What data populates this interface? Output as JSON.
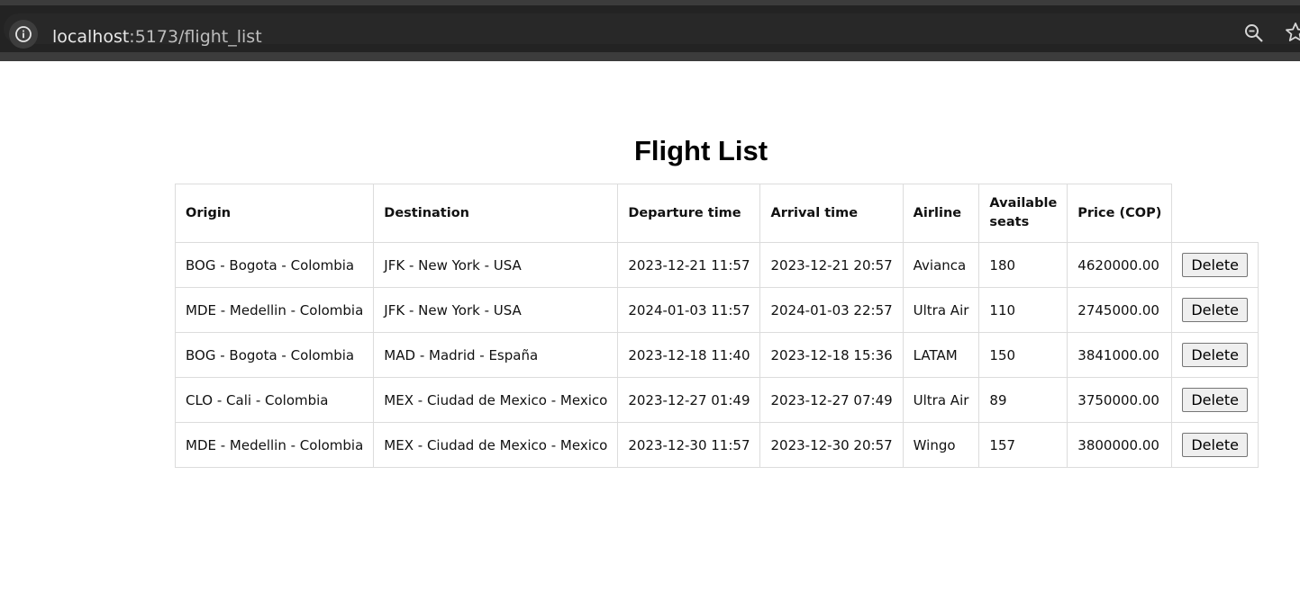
{
  "browser": {
    "url_host": "localhost",
    "url_path": ":5173/flight_list"
  },
  "page": {
    "title": "Flight List"
  },
  "table": {
    "headers": [
      "Origin",
      "Destination",
      "Departure time",
      "Arrival time",
      "Airline",
      "Available seats",
      "Price (COP)"
    ],
    "rows": [
      [
        "BOG - Bogota - Colombia",
        "JFK - New York - USA",
        "2023-12-21 11:57",
        "2023-12-21 20:57",
        "Avianca",
        "180",
        "4620000.00"
      ],
      [
        "MDE - Medellin - Colombia",
        "JFK - New York - USA",
        "2024-01-03 11:57",
        "2024-01-03 22:57",
        "Ultra Air",
        "110",
        "2745000.00"
      ],
      [
        "BOG - Bogota - Colombia",
        "MAD - Madrid - España",
        "2023-12-18 11:40",
        "2023-12-18 15:36",
        "LATAM",
        "150",
        "3841000.00"
      ],
      [
        "CLO - Cali - Colombia",
        "MEX - Ciudad de Mexico - Mexico",
        "2023-12-27 01:49",
        "2023-12-27 07:49",
        "Ultra Air",
        "89",
        "3750000.00"
      ],
      [
        "MDE - Medellin - Colombia",
        "MEX - Ciudad de Mexico - Mexico",
        "2023-12-30 11:57",
        "2023-12-30 20:57",
        "Wingo",
        "157",
        "3800000.00"
      ]
    ],
    "delete_label": "Delete"
  },
  "icons": {
    "site_info": "info-circle-icon",
    "zoom": "magnifier-icon",
    "bookmark": "star-icon"
  }
}
